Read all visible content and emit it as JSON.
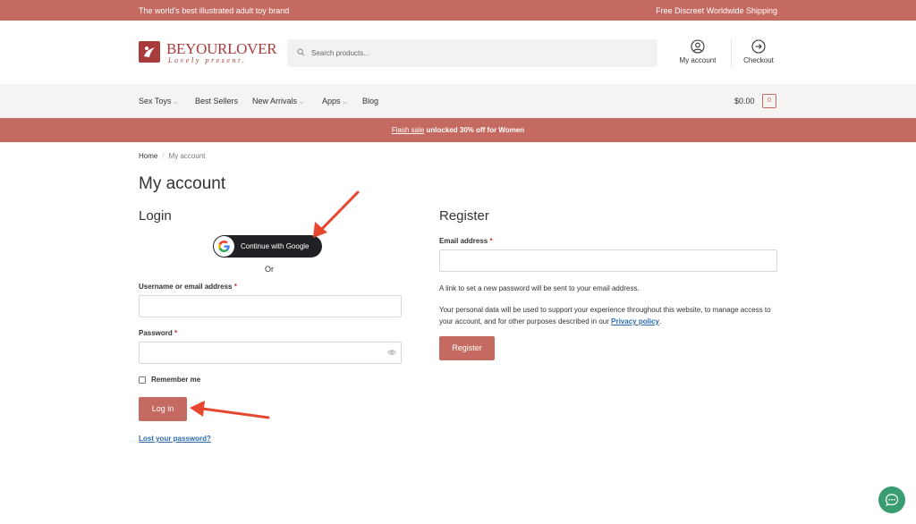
{
  "topbar": {
    "left_text": "The world's best illustrated adult toy brand",
    "right_text": "Free Discreet Worldwide Shipping"
  },
  "header": {
    "logo_title": "BEYOURLOVER",
    "logo_tagline": "Lovely present.",
    "search_placeholder": "Search products...",
    "account_label": "My account",
    "checkout_label": "Checkout"
  },
  "nav": {
    "items": [
      {
        "label": "Sex Toys",
        "has_dropdown": true
      },
      {
        "label": "Best Sellers",
        "has_dropdown": false
      },
      {
        "label": "New Arrivals",
        "has_dropdown": true
      },
      {
        "label": "Apps",
        "has_dropdown": true
      },
      {
        "label": "Blog",
        "has_dropdown": false
      }
    ],
    "cart_total": "$0.00",
    "cart_count": "0"
  },
  "promo": {
    "link_text": "Flash sale",
    "text": "unlocked 30% off for Women"
  },
  "breadcrumb": {
    "home": "Home",
    "current": "My account"
  },
  "page_title": "My account",
  "login": {
    "heading": "Login",
    "google_button": "Continue with Google",
    "or_text": "Or",
    "username_label": "Username or email address",
    "password_label": "Password",
    "required_mark": "*",
    "remember_label": "Remember me",
    "submit_label": "Log in",
    "lost_password": "Lost your password?"
  },
  "register": {
    "heading": "Register",
    "email_label": "Email address",
    "required_mark": "*",
    "info_text": "A link to set a new password will be sent to your email address.",
    "privacy_text": "Your personal data will be used to support your experience throughout this website, to manage access to your account, and for other purposes described in our",
    "privacy_link": "Privacy policy",
    "privacy_end": ".",
    "submit_label": "Register"
  },
  "colors": {
    "brand": "#c46a60",
    "logo": "#a83b3b",
    "annotation_arrow": "#e8472f",
    "chat": "#3a9d72",
    "link": "#2b6cb0"
  }
}
